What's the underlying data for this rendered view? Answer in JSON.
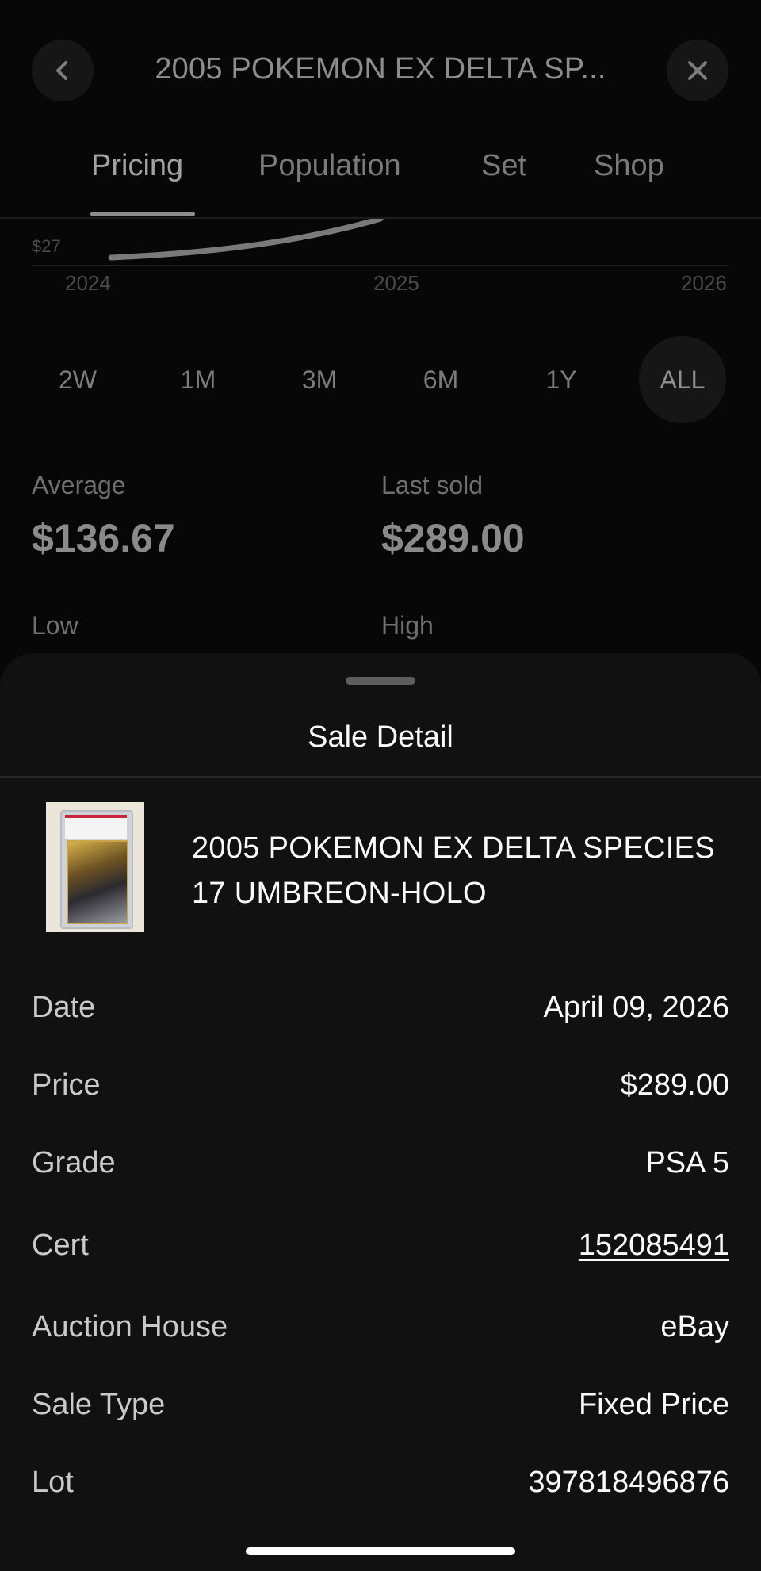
{
  "header": {
    "title": "2005 POKEMON EX DELTA SP...",
    "back_icon": "chevron-left-icon",
    "close_icon": "close-icon"
  },
  "tabs": [
    {
      "label": "Pricing",
      "active": true
    },
    {
      "label": "Population",
      "active": false
    },
    {
      "label": "Set",
      "active": false
    },
    {
      "label": "Shop",
      "active": false
    }
  ],
  "chart_data": {
    "type": "line",
    "y_min_label": "$27",
    "x_ticks": [
      "2024",
      "2025",
      "2026"
    ]
  },
  "ranges": [
    {
      "label": "2W",
      "active": false
    },
    {
      "label": "1M",
      "active": false
    },
    {
      "label": "3M",
      "active": false
    },
    {
      "label": "6M",
      "active": false
    },
    {
      "label": "1Y",
      "active": false
    },
    {
      "label": "ALL",
      "active": true
    }
  ],
  "stats": {
    "average_label": "Average",
    "average_value": "$136.67",
    "last_sold_label": "Last sold",
    "last_sold_value": "$289.00",
    "low_label": "Low",
    "high_label": "High"
  },
  "sheet": {
    "title": "Sale Detail",
    "card_name": "2005 POKEMON EX DELTA SPECIES 17 UMBREON-HOLO",
    "details": [
      {
        "label": "Date",
        "value": "April 09, 2026"
      },
      {
        "label": "Price",
        "value": "$289.00"
      },
      {
        "label": "Grade",
        "value": "PSA 5"
      },
      {
        "label": "Cert",
        "value": "152085491"
      },
      {
        "label": "Auction House",
        "value": "eBay"
      },
      {
        "label": "Sale Type",
        "value": "Fixed Price"
      },
      {
        "label": "Lot",
        "value": "397818496876"
      }
    ]
  }
}
